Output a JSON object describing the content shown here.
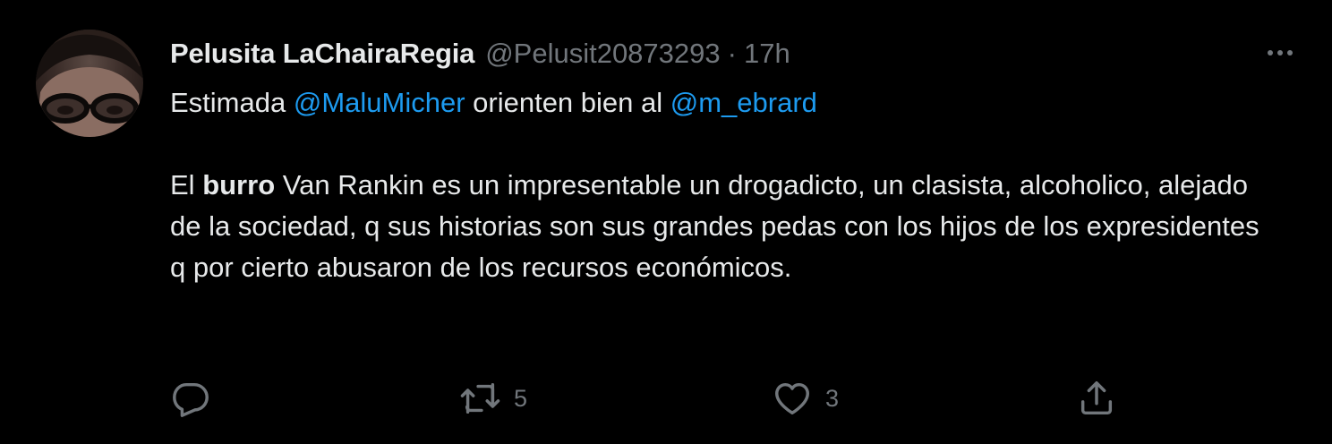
{
  "author": {
    "display_name": "Pelusita LaChairaRegia",
    "handle": "@Pelusit20873293",
    "separator": "·",
    "timestamp": "17h",
    "avatar_icon": "profile-photo"
  },
  "tweet": {
    "line1": {
      "prefix": "Estimada ",
      "mention1": "@MaluMicher",
      "middle": " orienten bien al ",
      "mention2": "@m_ebrard"
    },
    "paragraph2": {
      "lead": "El ",
      "bold_word": "burro",
      "rest": " Van Rankin es un impresentable un drogadicto, un clasista, alcoholico, alejado de la sociedad, q sus historias son sus grandes pedas con los hijos de los expresidentes q por cierto abusaron de los recursos económicos."
    }
  },
  "actions": {
    "reply": {
      "icon": "reply-icon",
      "count": ""
    },
    "retweet": {
      "icon": "retweet-icon",
      "count": "5"
    },
    "like": {
      "icon": "heart-icon",
      "count": "3"
    },
    "share": {
      "icon": "share-icon"
    }
  },
  "colors": {
    "background": "#000000",
    "text": "#e7e9ea",
    "secondary": "#71767b",
    "mention": "#1d9bf0"
  }
}
